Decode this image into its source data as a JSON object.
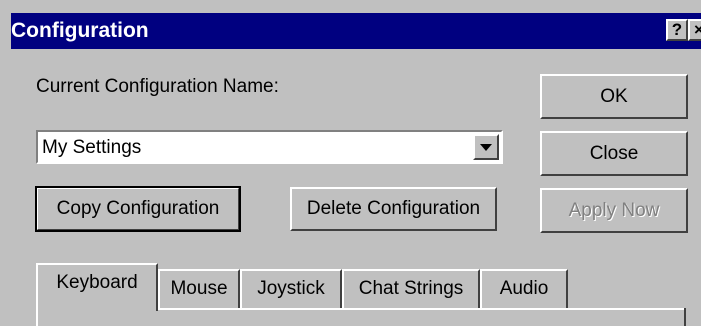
{
  "window": {
    "title": "Configuration",
    "help_button": "?",
    "close_button": "×"
  },
  "config": {
    "name_label": "Current Configuration Name:",
    "selected_value": "My Settings"
  },
  "buttons": {
    "ok": "OK",
    "close": "Close",
    "apply_now": "Apply Now",
    "copy_configuration": "Copy Configuration",
    "delete_configuration": "Delete Configuration"
  },
  "tabs": [
    {
      "label": "Keyboard",
      "active": true
    },
    {
      "label": "Mouse",
      "active": false
    },
    {
      "label": "Joystick",
      "active": false
    },
    {
      "label": "Chat Strings",
      "active": false
    },
    {
      "label": "Audio",
      "active": false
    }
  ],
  "colors": {
    "titlebar": "#000080",
    "face": "#c0c0c0"
  }
}
